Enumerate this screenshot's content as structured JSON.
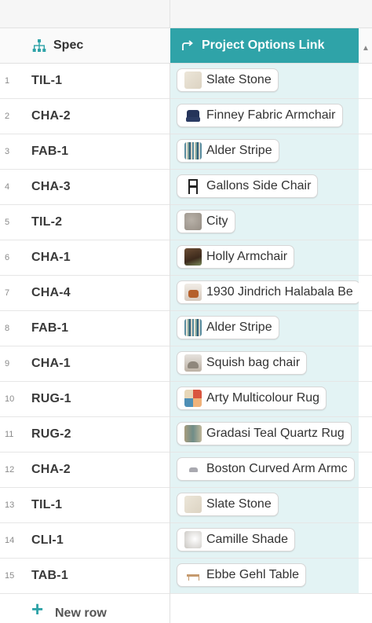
{
  "header": {
    "spec_label": "Spec",
    "project_label": "Project Options Link",
    "project_color": "#2fa3a8",
    "cell_tint": "#e3f3f4"
  },
  "rows": [
    {
      "num": "1",
      "spec": "TIL-1",
      "item": "Slate Stone",
      "thumb": "slate"
    },
    {
      "num": "2",
      "spec": "CHA-2",
      "item": "Finney Fabric Armchair",
      "thumb": "finney"
    },
    {
      "num": "3",
      "spec": "FAB-1",
      "item": "Alder Stripe",
      "thumb": "stripe"
    },
    {
      "num": "4",
      "spec": "CHA-3",
      "item": "Gallons Side Chair",
      "thumb": "gallons"
    },
    {
      "num": "5",
      "spec": "TIL-2",
      "item": "City",
      "thumb": "city"
    },
    {
      "num": "6",
      "spec": "CHA-1",
      "item": "Holly Armchair",
      "thumb": "holly"
    },
    {
      "num": "7",
      "spec": "CHA-4",
      "item": "1930 Jindrich Halabala Be",
      "thumb": "1930"
    },
    {
      "num": "8",
      "spec": "FAB-1",
      "item": "Alder Stripe",
      "thumb": "stripe"
    },
    {
      "num": "9",
      "spec": "CHA-1",
      "item": "Squish bag chair",
      "thumb": "squish"
    },
    {
      "num": "10",
      "spec": "RUG-1",
      "item": "Arty Multicolour Rug",
      "thumb": "arty"
    },
    {
      "num": "11",
      "spec": "RUG-2",
      "item": "Gradasi Teal Quartz Rug",
      "thumb": "gradasi"
    },
    {
      "num": "12",
      "spec": "CHA-2",
      "item": "Boston Curved Arm Armc",
      "thumb": "boston"
    },
    {
      "num": "13",
      "spec": "TIL-1",
      "item": "Slate Stone",
      "thumb": "slate"
    },
    {
      "num": "14",
      "spec": "CLI-1",
      "item": "Camille Shade",
      "thumb": "camille"
    },
    {
      "num": "15",
      "spec": "TAB-1",
      "item": "Ebbe Gehl Table",
      "thumb": "ebbe"
    }
  ],
  "footer": {
    "new_row_label": "New row",
    "plus_symbol": "+"
  }
}
